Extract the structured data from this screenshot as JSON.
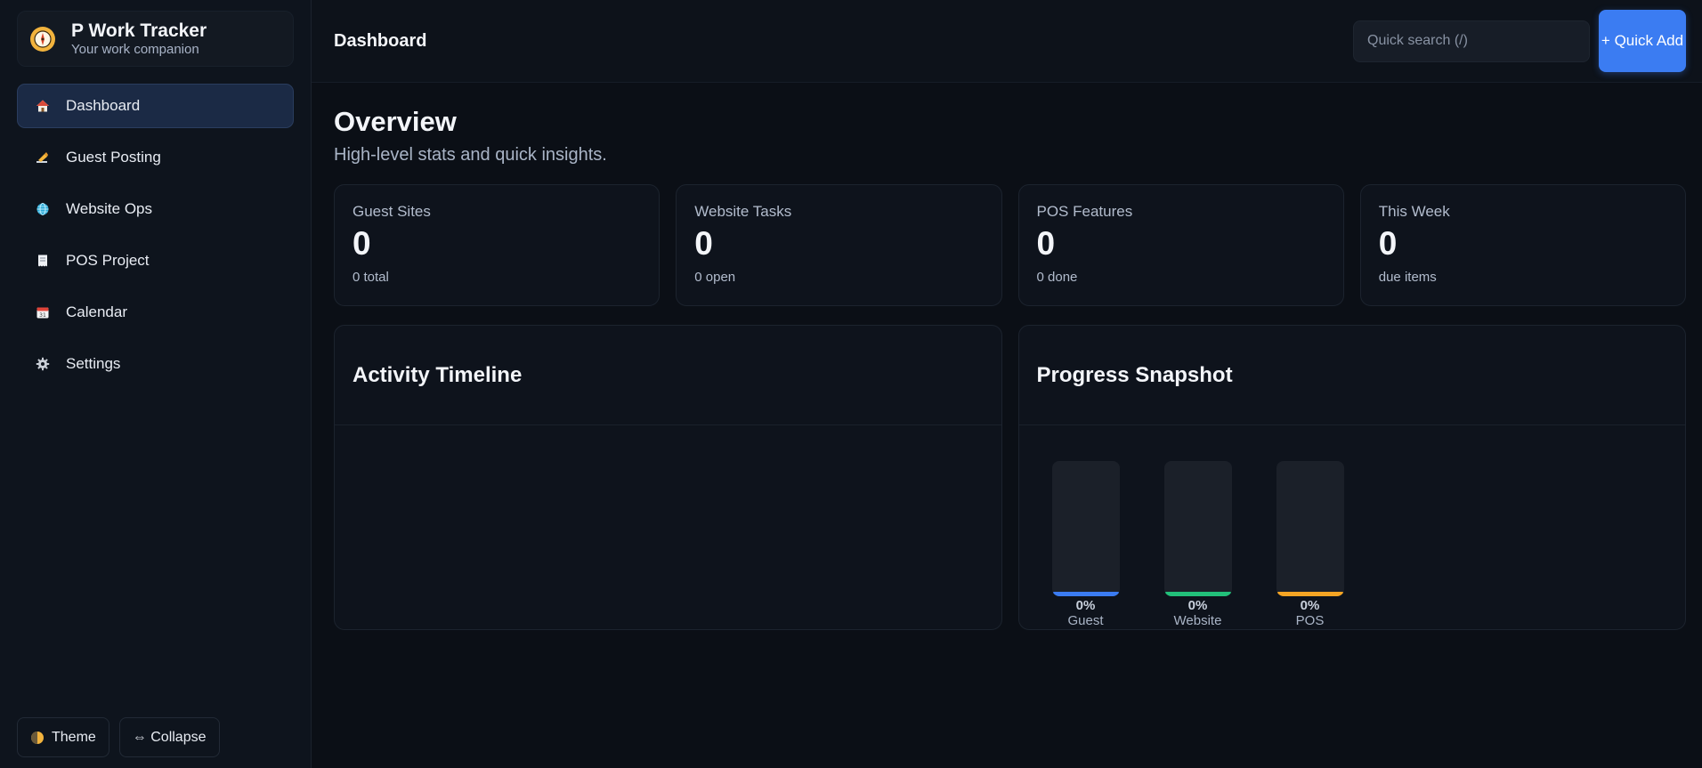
{
  "brand": {
    "title": "P Work Tracker",
    "subtitle": "Your work companion",
    "logo_icon": "compass-icon"
  },
  "sidebar": {
    "items": [
      {
        "label": "Dashboard",
        "icon": "house-icon",
        "active": true
      },
      {
        "label": "Guest Posting",
        "icon": "writing-hand-icon",
        "active": false
      },
      {
        "label": "Website Ops",
        "icon": "globe-icon",
        "active": false
      },
      {
        "label": "POS Project",
        "icon": "receipt-icon",
        "active": false
      },
      {
        "label": "Calendar",
        "icon": "calendar-icon",
        "active": false
      },
      {
        "label": "Settings",
        "icon": "gear-icon",
        "active": false
      }
    ],
    "footer": {
      "theme_label": "Theme",
      "collapse_label": "⇔ Collapse"
    }
  },
  "topbar": {
    "title": "Dashboard",
    "search_placeholder": "Quick search (/)",
    "quick_add_label": "+ Quick Add"
  },
  "overview": {
    "title": "Overview",
    "subtitle": "High-level stats and quick insights."
  },
  "stats": [
    {
      "label": "Guest Sites",
      "value": "0",
      "meta": "0 total"
    },
    {
      "label": "Website Tasks",
      "value": "0",
      "meta": "0 open"
    },
    {
      "label": "POS Features",
      "value": "0",
      "meta": "0 done"
    },
    {
      "label": "This Week",
      "value": "0",
      "meta": "due items"
    }
  ],
  "panels": {
    "timeline_title": "Activity Timeline",
    "progress_title": "Progress Snapshot"
  },
  "chart_data": {
    "type": "bar",
    "categories": [
      "Guest",
      "Website",
      "POS"
    ],
    "values": [
      0,
      0,
      0
    ],
    "value_labels": [
      "0%",
      "0%",
      "0%"
    ],
    "ylim": [
      0,
      100
    ],
    "colors": [
      "#3b7cf2",
      "#22c07a",
      "#f5a524"
    ],
    "title": "Progress Snapshot"
  },
  "colors": {
    "accent": "#3b7cf2",
    "guest": "#3b7cf2",
    "website": "#22c07a",
    "pos": "#f5a524"
  }
}
